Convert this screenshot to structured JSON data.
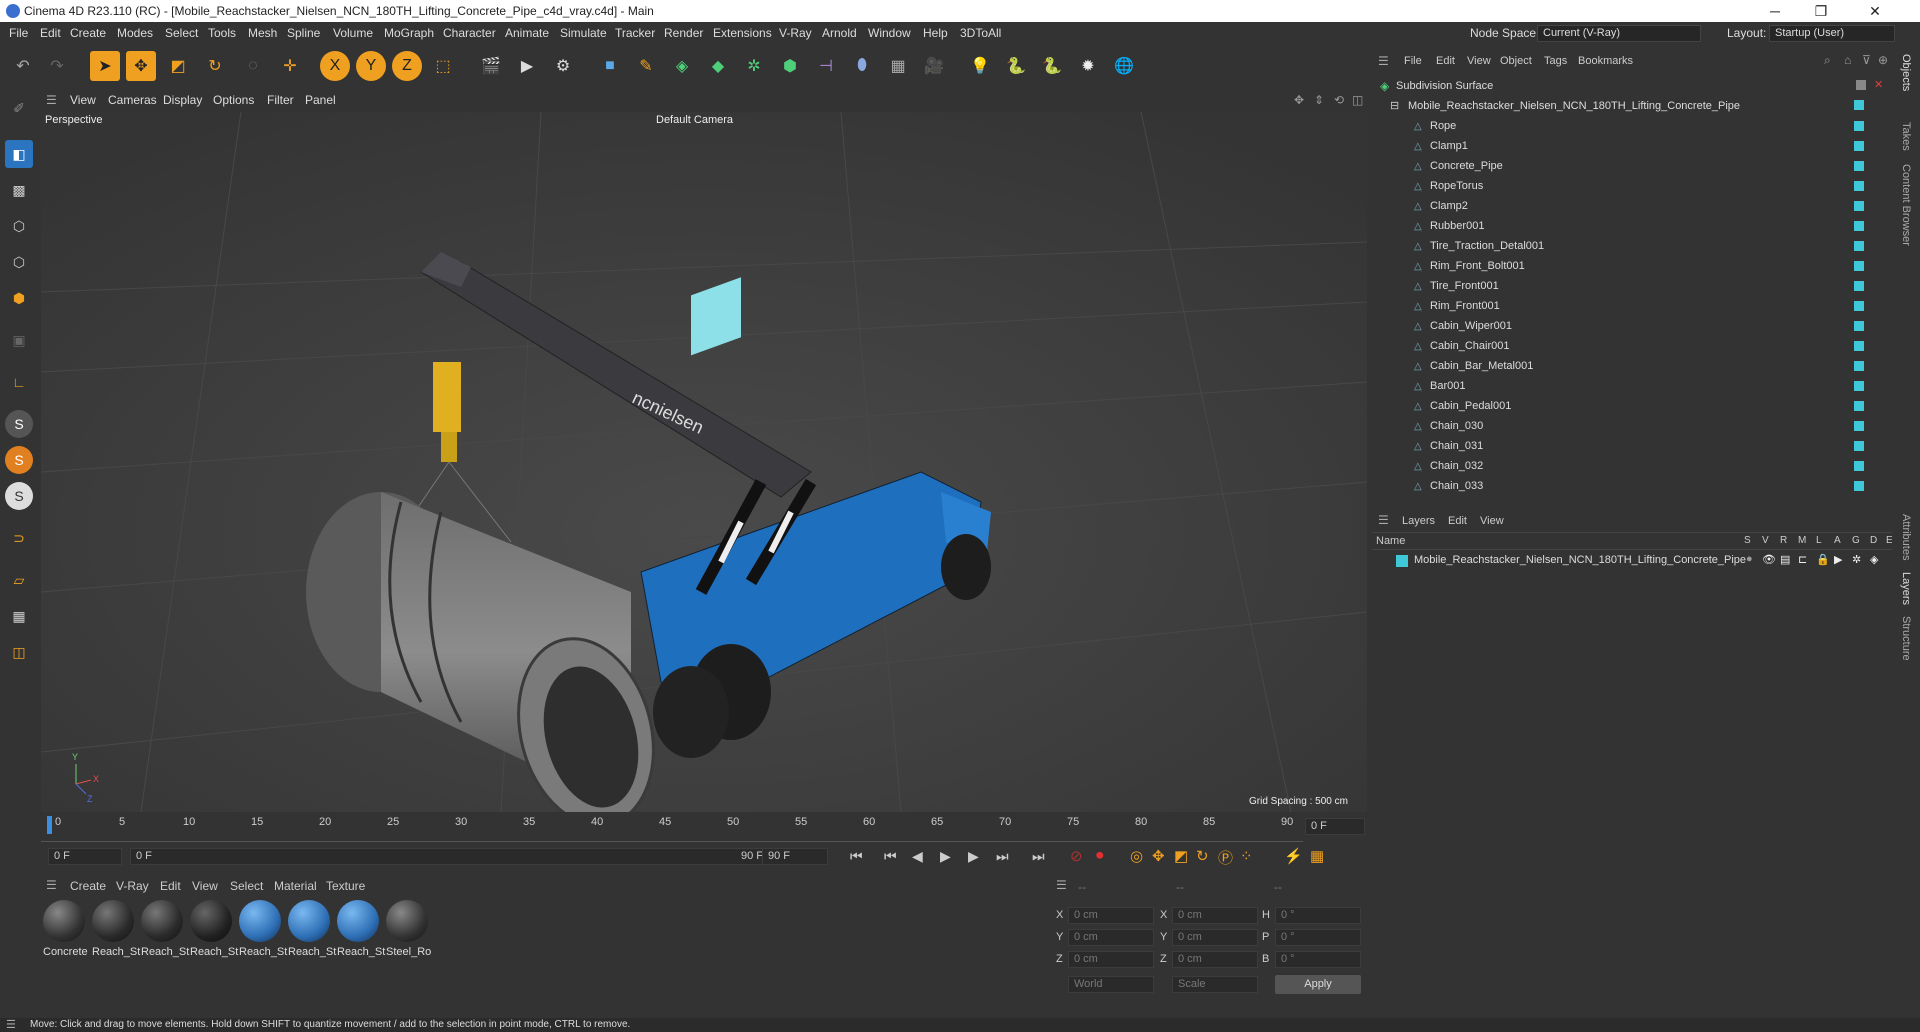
{
  "window": {
    "title": "Cinema 4D R23.110 (RC) - [Mobile_Reachstacker_Nielsen_NCN_180TH_Lifting_Concrete_Pipe_c4d_vray.c4d] - Main",
    "min": "─",
    "max": "❐",
    "close": "✕"
  },
  "menu": [
    "File",
    "Edit",
    "Create",
    "Modes",
    "Select",
    "Tools",
    "Mesh",
    "Spline",
    "Volume",
    "MoGraph",
    "Character",
    "Animate",
    "Simulate",
    "Tracker",
    "Render",
    "Extensions",
    "V-Ray",
    "Arnold",
    "Window",
    "Help",
    "3DToAll"
  ],
  "nodespace": {
    "label": "Node Space:",
    "value": "Current (V-Ray)"
  },
  "layout": {
    "label": "Layout:",
    "value": "Startup (User)"
  },
  "toolbar_icons": [
    "undo-icon",
    "redo-icon",
    "select-icon",
    "move-icon",
    "scale-icon",
    "rotate-icon",
    "live-select-icon",
    "add-icon",
    "x-axis-icon",
    "y-axis-icon",
    "z-axis-icon",
    "coord-system-icon",
    "render-region-icon",
    "render-view-icon",
    "render-settings-icon",
    "cube-icon",
    "pen-icon",
    "subdivision-icon",
    "extrude-icon",
    "cloner-icon",
    "mograph-icon",
    "deformer-icon",
    "field-icon",
    "floor-icon",
    "camera-icon",
    "light-icon",
    "python-icon",
    "python2-icon",
    "gear-icon",
    "globe-icon"
  ],
  "viewport_menu": [
    "View",
    "Cameras",
    "Display",
    "Options",
    "Filter",
    "Panel"
  ],
  "viewport": {
    "name": "Perspective",
    "camera": "Default Camera",
    "grid_spacing": "Grid Spacing : 500 cm",
    "brand_text": "ncnielsen"
  },
  "timeline": {
    "ticks": [
      "0",
      "5",
      "10",
      "15",
      "20",
      "25",
      "30",
      "35",
      "40",
      "45",
      "50",
      "55",
      "60",
      "65",
      "70",
      "75",
      "80",
      "85",
      "90"
    ],
    "current": "0 F"
  },
  "transport": {
    "start": "0 F",
    "range_start": "0 F",
    "range_end": "90 F",
    "end": "90 F"
  },
  "material_menu": [
    "Create",
    "V-Ray",
    "Edit",
    "View",
    "Select",
    "Material",
    "Texture"
  ],
  "materials": [
    {
      "label": "Concrete",
      "color": "#555"
    },
    {
      "label": "Reach_St",
      "color": "#555"
    },
    {
      "label": "Reach_St",
      "color": "#555"
    },
    {
      "label": "Reach_St",
      "color": "#444"
    },
    {
      "label": "Reach_St",
      "color": "#2e6fb5"
    },
    {
      "label": "Reach_St",
      "color": "#2e6fb5"
    },
    {
      "label": "Reach_St",
      "color": "#2e6fb5"
    },
    {
      "label": "Steel_Ro",
      "color": "#555"
    }
  ],
  "coords": {
    "headers": [
      "--",
      "--",
      "--"
    ],
    "rows": [
      {
        "a": "X",
        "v1": "0 cm",
        "b": "X",
        "v2": "0 cm",
        "c": "H",
        "v3": "0 °"
      },
      {
        "a": "Y",
        "v1": "0 cm",
        "b": "Y",
        "v2": "0 cm",
        "c": "P",
        "v3": "0 °"
      },
      {
        "a": "Z",
        "v1": "0 cm",
        "b": "Z",
        "v2": "0 cm",
        "c": "B",
        "v3": "0 °"
      }
    ],
    "space": "World",
    "mode": "Scale",
    "apply": "Apply"
  },
  "status": "Move: Click and drag to move elements. Hold down SHIFT to quantize movement / add to the selection in point mode, CTRL to remove.",
  "objects_menu": [
    "File",
    "Edit",
    "View",
    "Object",
    "Tags",
    "Bookmarks"
  ],
  "objects": {
    "root": "Subdivision Surface",
    "group": "Mobile_Reachstacker_Nielsen_NCN_180TH_Lifting_Concrete_Pipe",
    "items": [
      "Rope",
      "Clamp1",
      "Concrete_Pipe",
      "RopeTorus",
      "Clamp2",
      "Rubber001",
      "Tire_Traction_Detal001",
      "Rim_Front_Bolt001",
      "Tire_Front001",
      "Rim_Front001",
      "Cabin_Wiper001",
      "Cabin_Chair001",
      "Cabin_Bar_Metal001",
      "Bar001",
      "Cabin_Pedal001",
      "Chain_030",
      "Chain_031",
      "Chain_032",
      "Chain_033"
    ]
  },
  "layers_menu": [
    "Layers",
    "Edit",
    "View"
  ],
  "layers": {
    "name_header": "Name",
    "flags": [
      "S",
      "V",
      "R",
      "M",
      "L",
      "A",
      "G",
      "D",
      "E"
    ],
    "item": "Mobile_Reachstacker_Nielsen_NCN_180TH_Lifting_Concrete_Pipe"
  },
  "side_tabs": [
    "Objects",
    "Takes",
    "Content Browser",
    "Attributes",
    "Layers",
    "Structure"
  ],
  "colors": {
    "accent": "#f0a020",
    "layer": "#3fc8d8",
    "blue": "#2e6fb5"
  }
}
